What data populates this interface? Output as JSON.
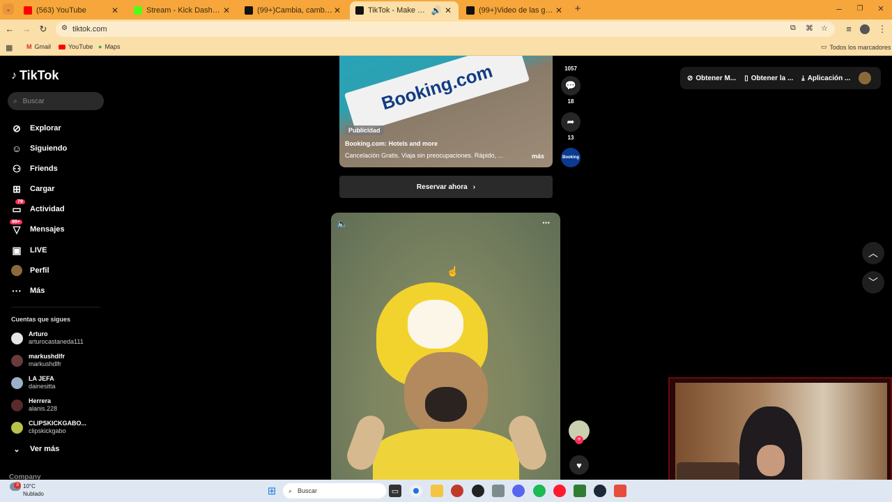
{
  "browser": {
    "tabs": [
      {
        "label": "(563) YouTube",
        "color": "#ff0000"
      },
      {
        "label": "Stream - Kick Dashboard",
        "color": "#53fc18"
      },
      {
        "label": "(99+)Cambia, cambia... ¡Es por",
        "color": "#111111"
      },
      {
        "label": "TikTok - Make Your Day",
        "color": "#111111",
        "active": true
      },
      {
        "label": "(99+)Video de las gemelas (@",
        "color": "#111111"
      }
    ],
    "url": "tiktok.com",
    "bookmarks": [
      "Gmail",
      "YouTube",
      "Maps"
    ],
    "all_bookmarks": "Todos los marcadores"
  },
  "sidebar": {
    "logo": "TikTok",
    "search_placeholder": "Buscar",
    "nav": [
      {
        "label": "Explorar",
        "icon": "compass-icon"
      },
      {
        "label": "Siguiendo",
        "icon": "following-icon"
      },
      {
        "label": "Friends",
        "icon": "friends-icon"
      },
      {
        "label": "Cargar",
        "icon": "upload-icon"
      },
      {
        "label": "Actividad",
        "icon": "activity-icon",
        "badge": "79"
      },
      {
        "label": "Mensajes",
        "icon": "messages-icon",
        "badge": "99+"
      },
      {
        "label": "LIVE",
        "icon": "live-icon"
      },
      {
        "label": "Perfil",
        "icon": "profile-avatar"
      },
      {
        "label": "Más",
        "icon": "more-icon"
      }
    ],
    "following_title": "Cuentas que sigues",
    "following": [
      {
        "name": "Arturo",
        "handle": "arturocastaneda111"
      },
      {
        "name": "markushdlfr",
        "handle": "markushdlfr"
      },
      {
        "name": "LA JEFA",
        "handle": "dainesitta"
      },
      {
        "name": "Herrera",
        "handle": "alanis.228"
      },
      {
        "name": "CLIPSKICKGABO...",
        "handle": "clipskickgabo"
      }
    ],
    "see_more": "Ver más",
    "company": "Company"
  },
  "ad": {
    "brand_text": "Booking.com",
    "tag": "Publicidad",
    "title": "Booking.com: Hotels and more",
    "description": "Cancelación Gratis. Viaja sin preocupaciones. Rápido, ...",
    "more": "más",
    "cta": "Reservar ahora",
    "likes": "1057",
    "comments": "18",
    "shares": "13",
    "avatar_text": "Booking"
  },
  "top_actions": {
    "points": "Obtener M...",
    "app": "Obtener la ...",
    "desktop": "Aplicación ..."
  },
  "taskbar": {
    "temp": "10°C",
    "weather": "Nublado",
    "notif": "3",
    "search": "Buscar"
  }
}
